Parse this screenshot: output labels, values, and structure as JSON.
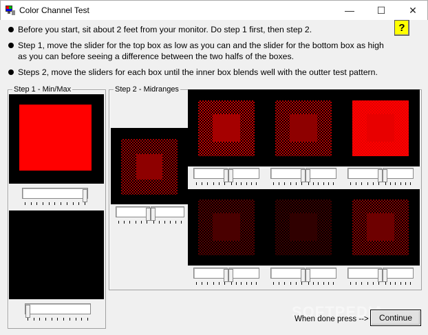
{
  "window": {
    "title": "Color Channel Test",
    "minimize": "—",
    "maximize": "☐",
    "close": "✕"
  },
  "instructions": [
    "Before you start, sit about 2 feet from your monitor.  Do step 1 first, then step 2.",
    "Step 1, move the slider for the top box as low as you can and the slider for the bottom box as high",
    "as you can before seeing a difference between the two halfs of the boxes.",
    "Steps 2, move the sliders for each box until the inner box blends well with the outter test pattern."
  ],
  "help_button": "?",
  "step1": {
    "label": "Step 1 - Min/Max",
    "top_slider_value": 0.93,
    "bottom_slider_value": 0.05
  },
  "step2": {
    "label": "Step 2 - Midranges"
  },
  "colors": {
    "red": "#ff0000",
    "dark_red_1": "#8e0000",
    "dark_red_2": "#6e0000",
    "dark_red_3": "#4a0000",
    "dark_red_4": "#3a0000"
  },
  "watermark": "SOFTPEDIA",
  "footer": {
    "done_label": "When done press -->",
    "continue_button": "Continue"
  }
}
